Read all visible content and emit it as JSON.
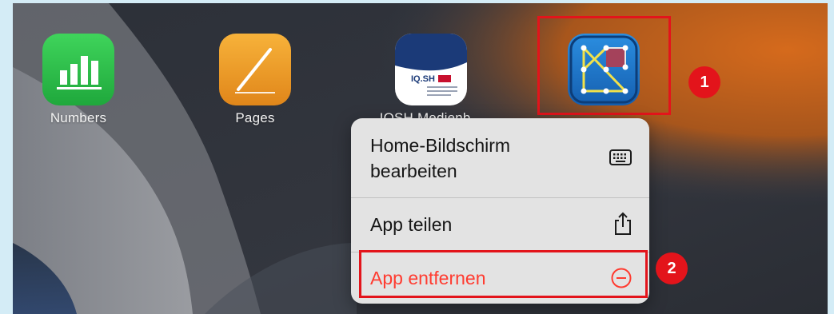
{
  "home_screen": {
    "apps": [
      {
        "name": "Numbers",
        "icon": "numbers-app-icon",
        "color": "#34c759"
      },
      {
        "name": "Pages",
        "icon": "pages-app-icon",
        "color": "#f39c12"
      },
      {
        "name": "IQSH Medienb...",
        "icon": "iqsh-app-icon",
        "icon_text": "IQ.SH"
      },
      {
        "name": "",
        "icon": "geoboard-app-icon",
        "color": "#1a74c8"
      }
    ]
  },
  "context_menu": {
    "items": [
      {
        "label_line1": "Home-Bildschirm",
        "label_line2": "bearbeiten",
        "icon": "keyboard-icon"
      },
      {
        "label": "App teilen",
        "icon": "share-icon"
      },
      {
        "label": "App entfernen",
        "icon": "minus-circle-icon",
        "color": "#ff3b30"
      }
    ]
  },
  "annotations": {
    "highlight_color": "#e3141b",
    "step1": "1",
    "step2": "2"
  }
}
